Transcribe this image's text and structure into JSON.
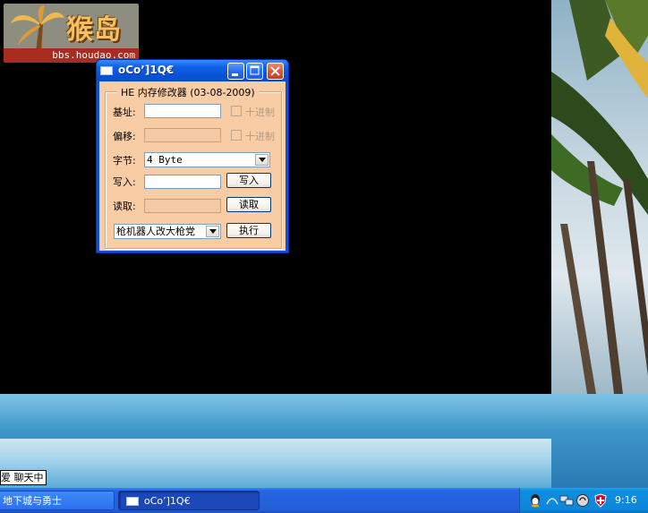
{
  "desktop": {
    "logo": {
      "text_cn": "猴岛",
      "url": "bbs.houdao.com"
    },
    "chat_popup": "爱 聊天中"
  },
  "window": {
    "title": "oCo’]1Q€",
    "controls": {
      "minimize": "minimize-icon",
      "maximize": "maximize-icon",
      "close": "close-icon"
    },
    "group_title": "HE 内存修改器 (03-08-2009)",
    "base_label": "基址:",
    "base_value": "",
    "base_hex_checkbox": {
      "label": "十进制",
      "checked": false
    },
    "offset_label": "偏移:",
    "offset_value": "",
    "offset_hex_checkbox": {
      "label": "十进制",
      "checked": false
    },
    "byte_label": "字节:",
    "byte_selected": "4 Byte",
    "write_label": "写入:",
    "write_value": "",
    "write_button": "写入",
    "read_label": "读取:",
    "read_value": "",
    "read_button": "读取",
    "function_selected": "枪机器人改大枪党",
    "execute_button": "执行"
  },
  "taskbar": {
    "items": [
      {
        "label": "地下城与勇士"
      },
      {
        "label": "oCo’]1Q€"
      }
    ],
    "tray_icons": [
      "qq-icon",
      "network-icon",
      "network-icon-2",
      "antivirus-icon",
      "shield-icon"
    ],
    "clock": "9:16"
  },
  "colors": {
    "dialog_bg": "#f8cda6",
    "title_blue": "#0a52d8",
    "taskbar_blue": "#245fd8"
  }
}
